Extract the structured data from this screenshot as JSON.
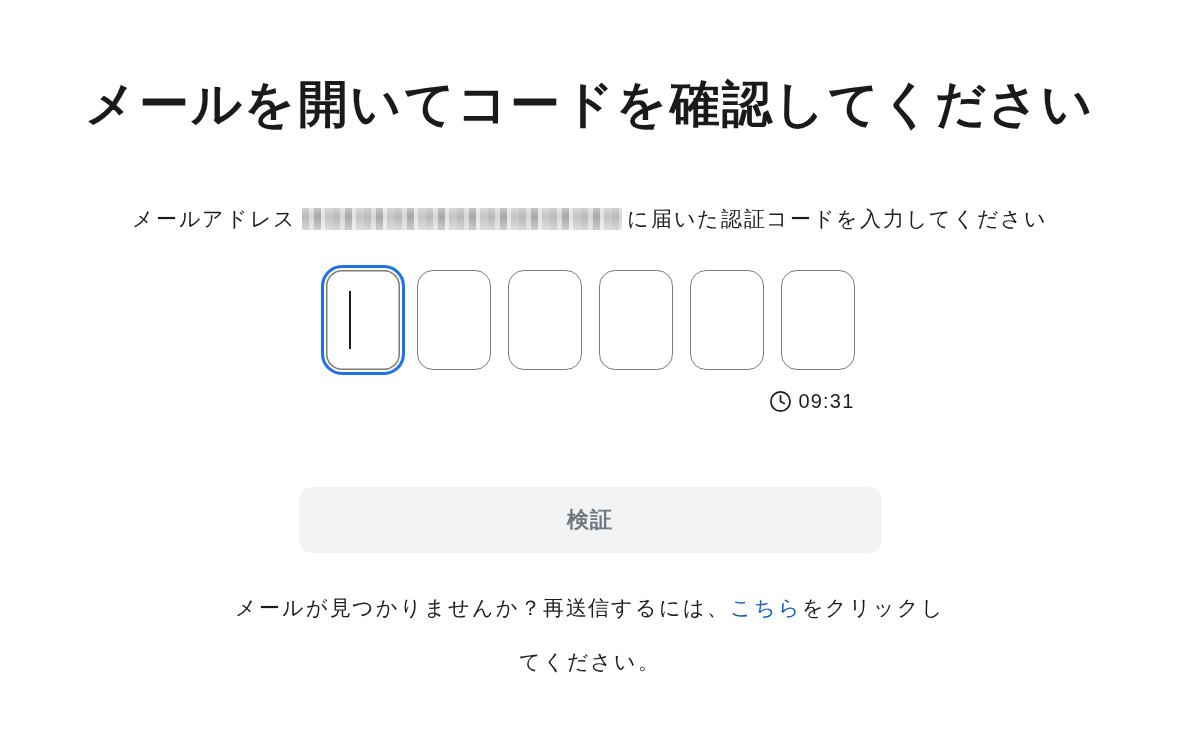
{
  "title": "メールを開いてコードを確認してください",
  "instruction": {
    "before": "メールアドレス",
    "email_masked": true,
    "after": "に届いた認証コードを入力してください"
  },
  "code_inputs": [
    {
      "focused": true
    },
    {
      "focused": false
    },
    {
      "focused": false
    },
    {
      "focused": false
    },
    {
      "focused": false
    },
    {
      "focused": false
    }
  ],
  "timer": "09:31",
  "verify_button": {
    "label": "検証",
    "disabled": true
  },
  "resend_prompt": {
    "before": "メールが見つかりませんか？再送信するには、",
    "link": "こちら",
    "after": "をクリックしてください。"
  }
}
